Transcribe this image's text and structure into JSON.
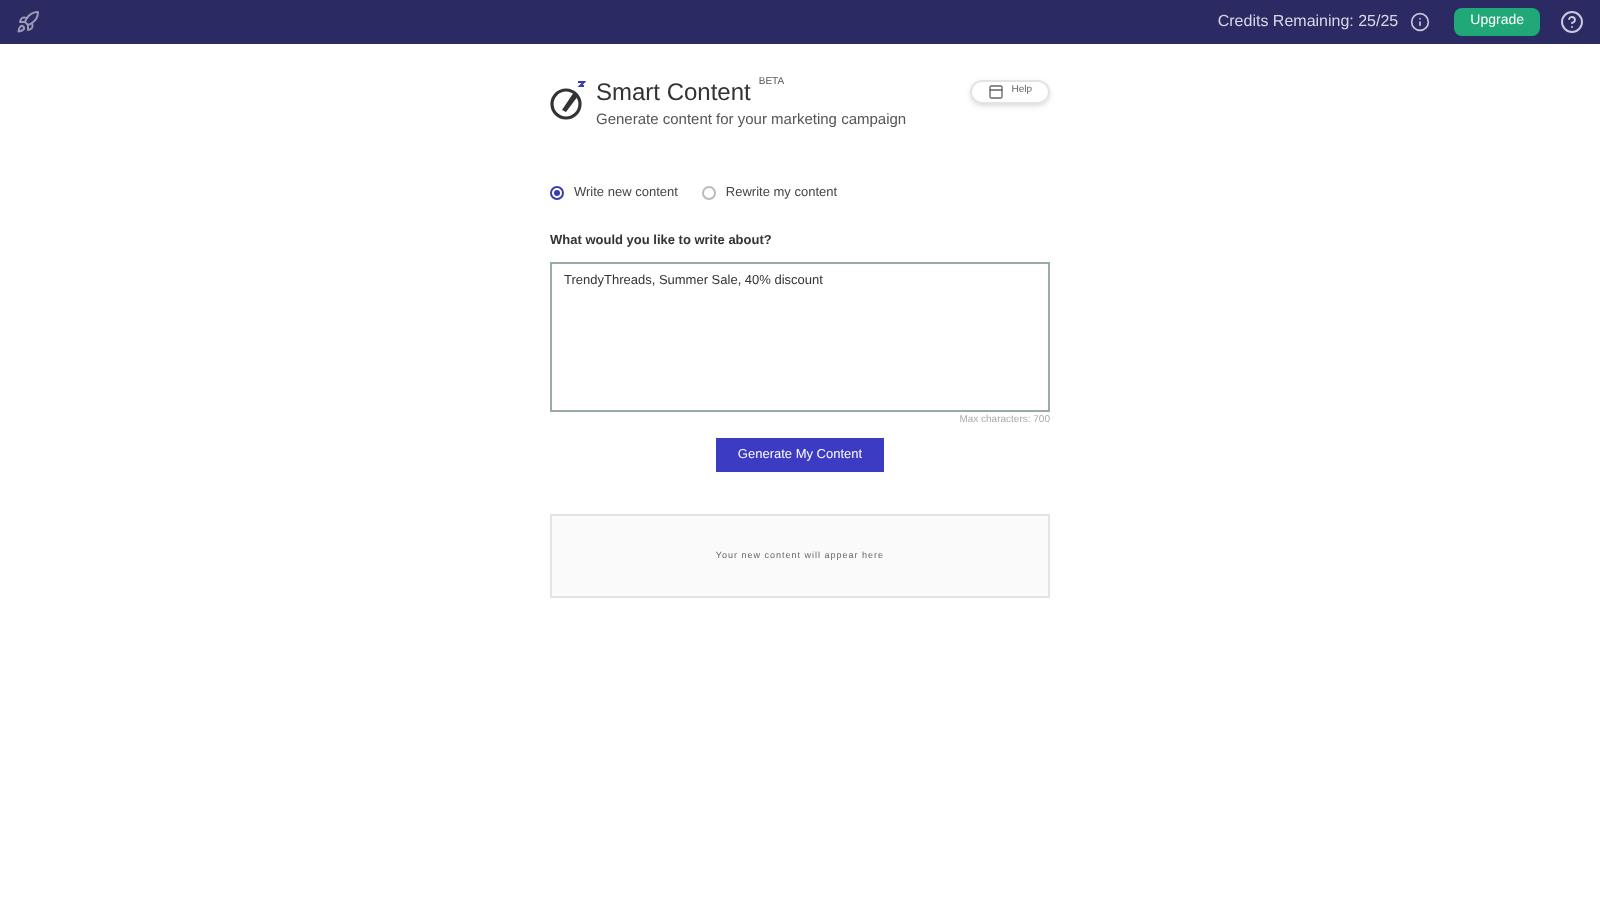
{
  "top_bar": {
    "credits": "Credits Remaining: 25/25",
    "upgrade_button": "Upgrade"
  },
  "header": {
    "title": "Smart Content",
    "badge": "BETA",
    "subtitle": "Generate content for your marketing campaign",
    "help_button": "Help"
  },
  "modes": [
    {
      "label": "Write new content",
      "selected": true
    },
    {
      "label": "Rewrite my content",
      "selected": false
    }
  ],
  "prompt": {
    "label": "What would you like to write about?",
    "value": "TrendyThreads, Summer Sale, 40% discount",
    "hint": "Max characters: 700"
  },
  "generate_button": "Generate My Content",
  "output": {
    "placeholder": "Your new content will appear here"
  }
}
